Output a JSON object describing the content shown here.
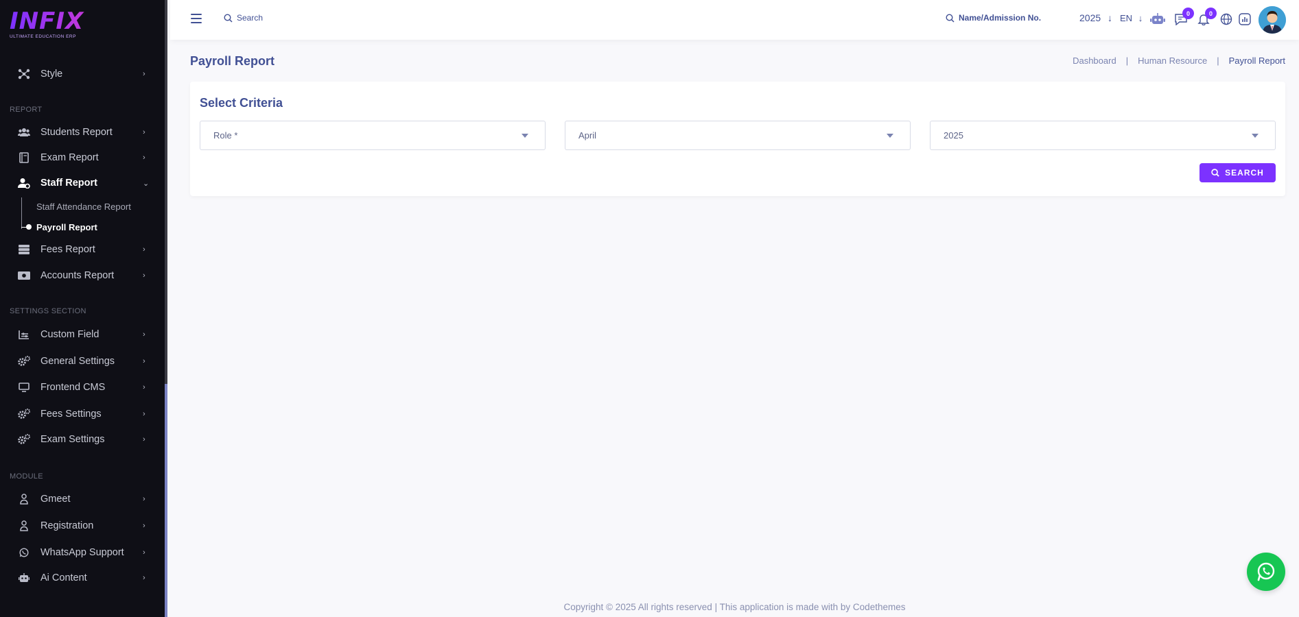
{
  "brand": {
    "name": "INFIX",
    "tagline": "ULTIMATE EDUCATION ERP"
  },
  "sidebar": {
    "items": [
      {
        "label": "Style",
        "icon": "style-icon"
      }
    ],
    "sections": {
      "report": "REPORT",
      "settings": "SETTINGS SECTION",
      "module": "MODULE"
    },
    "report_items": [
      {
        "label": "Students Report"
      },
      {
        "label": "Exam Report"
      },
      {
        "label": "Staff Report"
      },
      {
        "label": "Fees Report"
      },
      {
        "label": "Accounts Report"
      }
    ],
    "staff_sub": [
      {
        "label": "Staff Attendance Report"
      },
      {
        "label": "Payroll Report"
      }
    ],
    "settings_items": [
      {
        "label": "Custom Field"
      },
      {
        "label": "General Settings"
      },
      {
        "label": "Frontend CMS"
      },
      {
        "label": "Fees Settings"
      },
      {
        "label": "Exam Settings"
      }
    ],
    "module_items": [
      {
        "label": "Gmeet"
      },
      {
        "label": "Registration"
      },
      {
        "label": "WhatsApp Support"
      },
      {
        "label": "Ai Content"
      }
    ]
  },
  "header": {
    "search_label": "Search",
    "admission_search_label": "Name/Admission No.",
    "year": "2025",
    "language": "EN",
    "messages_count": "0",
    "notifications_count": "0"
  },
  "page": {
    "title": "Payroll Report",
    "breadcrumb": [
      "Dashboard",
      "Human Resource",
      "Payroll Report"
    ]
  },
  "criteria": {
    "title": "Select Criteria",
    "role_placeholder": "Role *",
    "month": "April",
    "year": "2025",
    "search_button": "SEARCH"
  },
  "footer": {
    "text": "Copyright © 2025 All rights reserved | This application is made with by Codethemes"
  },
  "colors": {
    "accent": "#7c32ff",
    "sidebar_bg": "#0f0f16",
    "primary_text": "#415094",
    "whatsapp": "#17c653"
  }
}
